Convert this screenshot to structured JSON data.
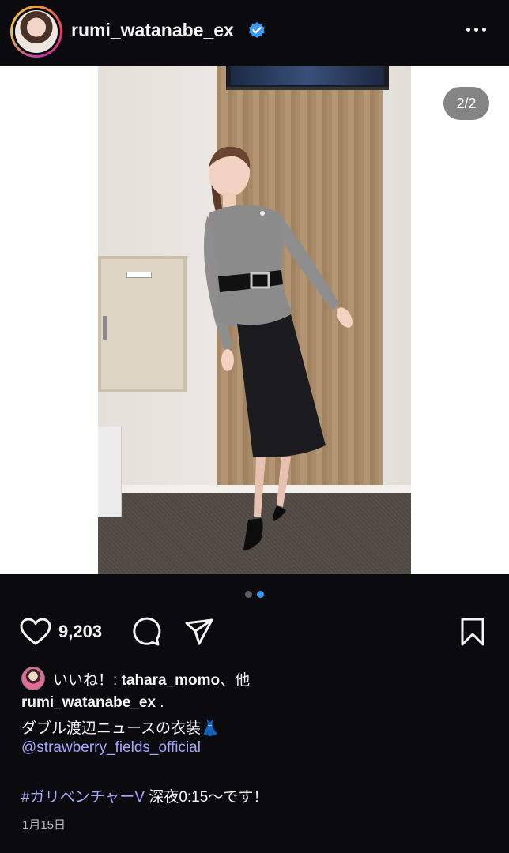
{
  "header": {
    "username": "rumi_watanabe_ex",
    "verified": true,
    "more_icon": "ellipsis-horizontal-icon"
  },
  "media": {
    "counter": "2/2",
    "total_slides": 2,
    "current_slide": 2
  },
  "actions": {
    "like_icon": "heart-outline-icon",
    "like_count": "9,203",
    "comment_icon": "speech-bubble-icon",
    "share_icon": "paper-plane-icon",
    "save_icon": "bookmark-outline-icon"
  },
  "liked_by": {
    "prefix": "いいね！: ",
    "user": "tahara_momo",
    "suffix": "、他"
  },
  "caption": {
    "username": "rumi_watanabe_ex",
    "username_suffix": " .",
    "line2": "ダブル渡辺ニュースの衣装👗",
    "mention": "@strawberry_fields_official",
    "hashtag": "#ガリベンチャーV",
    "hashline_rest": " 深夜0:15～です！"
  },
  "date": "1月15日",
  "colors": {
    "background": "#0b0b0f",
    "text": "#f5f5f5",
    "link": "#a3a8ff",
    "active_dot": "#3b97f3",
    "verified": "#3b97f3"
  }
}
